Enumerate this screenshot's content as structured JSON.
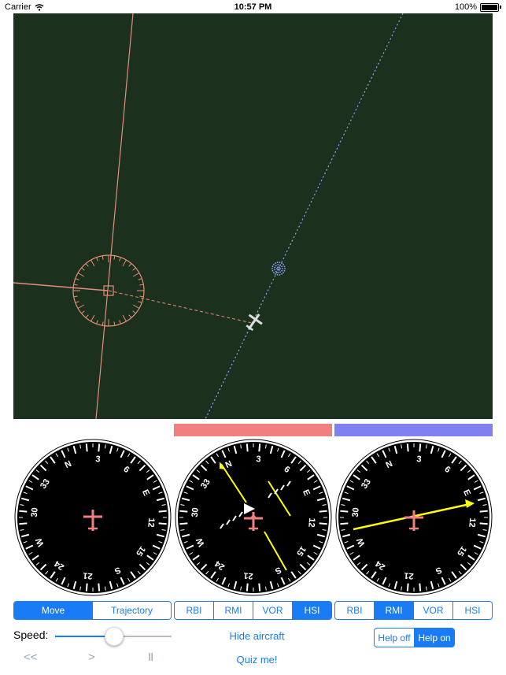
{
  "status_bar": {
    "carrier": "Carrier",
    "time": "10:57 PM",
    "battery": "100%"
  },
  "instruments": {
    "compass_labels": [
      "N",
      "3",
      "6",
      "E",
      "12",
      "15",
      "S",
      "21",
      "24",
      "W",
      "30",
      "33"
    ]
  },
  "controls": {
    "mode_segment": {
      "items": [
        "Move",
        "Trajectory"
      ],
      "selected": "Move"
    },
    "red_segment": {
      "items": [
        "RBI",
        "RMI",
        "VOR",
        "HSI"
      ],
      "selected": "HSI"
    },
    "blue_segment": {
      "items": [
        "RBI",
        "RMI",
        "VOR",
        "HSI"
      ],
      "selected": "RMI"
    },
    "speed_label": "Speed:",
    "speed_value": 0.51,
    "hide_aircraft": "Hide aircraft",
    "quiz": "Quiz me!",
    "help_segment": {
      "items": [
        "Help off",
        "Help on"
      ],
      "selected": "Help on"
    },
    "rewind": "<<",
    "play": ">",
    "pause": "II"
  },
  "colors": {
    "accent": "#1a7cf5",
    "map_bg": "#1c311d",
    "red_station": "#f08080",
    "blue_station": "#8080f0",
    "needle": "#ffff00"
  }
}
